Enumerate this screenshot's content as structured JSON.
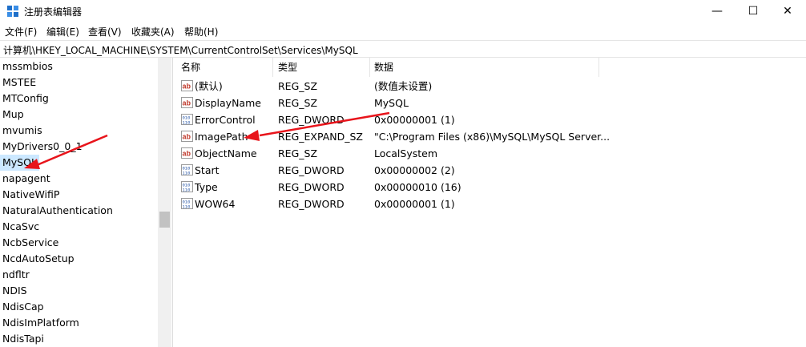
{
  "window": {
    "title": "注册表编辑器",
    "minimize": "—",
    "maximize": "☐",
    "close": "✕"
  },
  "menu": [
    "文件(F)",
    "编辑(E)",
    "查看(V)",
    "收藏夹(A)",
    "帮助(H)"
  ],
  "address": "计算机\\HKEY_LOCAL_MACHINE\\SYSTEM\\CurrentControlSet\\Services\\MySQL",
  "tree": [
    "mssmbios",
    "MSTEE",
    "MTConfig",
    "Mup",
    "mvumis",
    "MyDrivers0_0_1",
    "MySQL",
    "napagent",
    "NativeWifiP",
    "NaturalAuthentication",
    "NcaSvc",
    "NcbService",
    "NcdAutoSetup",
    "ndfltr",
    "NDIS",
    "NdisCap",
    "NdisImPlatform",
    "NdisTapi"
  ],
  "columns": {
    "name": "名称",
    "type": "类型",
    "data": "数据"
  },
  "values": [
    {
      "name": "(默认)",
      "type": "REG_SZ",
      "data": "(数值未设置)",
      "icon": "string-value-icon"
    },
    {
      "name": "DisplayName",
      "type": "REG_SZ",
      "data": "MySQL",
      "icon": "string-value-icon"
    },
    {
      "name": "ErrorControl",
      "type": "REG_DWORD",
      "data": "0x00000001 (1)",
      "icon": "binary-value-icon"
    },
    {
      "name": "ImagePath",
      "type": "REG_EXPAND_SZ",
      "data": "\"C:\\Program Files (x86)\\MySQL\\MySQL Server...",
      "icon": "string-value-icon"
    },
    {
      "name": "ObjectName",
      "type": "REG_SZ",
      "data": "LocalSystem",
      "icon": "string-value-icon"
    },
    {
      "name": "Start",
      "type": "REG_DWORD",
      "data": "0x00000002 (2)",
      "icon": "binary-value-icon"
    },
    {
      "name": "Type",
      "type": "REG_DWORD",
      "data": "0x00000010 (16)",
      "icon": "binary-value-icon"
    },
    {
      "name": "WOW64",
      "type": "REG_DWORD",
      "data": "0x00000001 (1)",
      "icon": "binary-value-icon"
    }
  ],
  "colors": {
    "selection": "#cce8ff",
    "annotation": "#e8141b"
  }
}
